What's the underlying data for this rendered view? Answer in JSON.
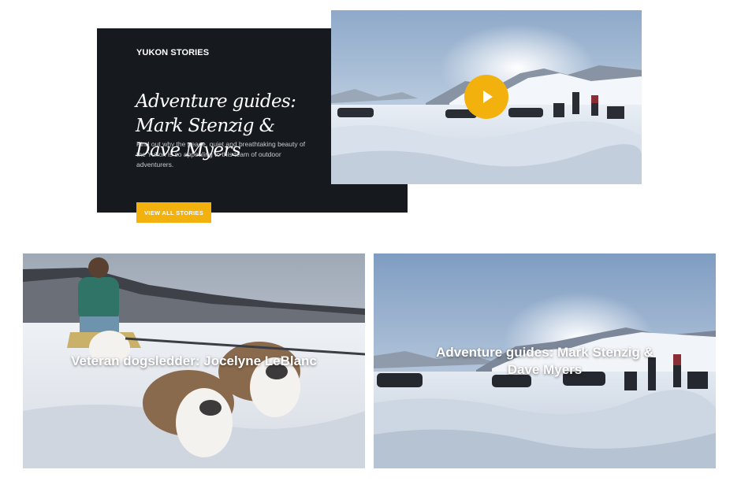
{
  "feature": {
    "eyebrow": "YUKON STORIES",
    "title": "Adventure guides: Mark Stenzig & Dave Myers",
    "description": "Find out why the peace, quiet and breathtaking beauty of the Yukon is so appealing to this team of outdoor adventurers.",
    "cta_label": "VIEW ALL STORIES",
    "play_icon": "play-icon"
  },
  "stories": [
    {
      "title": "Veteran dogsledder: Jocelyne LeBlanc"
    },
    {
      "title": "Adventure guides: Mark Stenzig & Dave Myers"
    }
  ],
  "colors": {
    "accent": "#f2b10c",
    "panel": "#16191e",
    "text_on_dark": "#ffffff"
  }
}
